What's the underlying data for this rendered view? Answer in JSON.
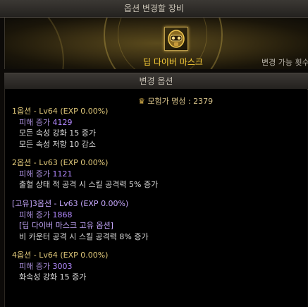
{
  "header": {
    "title": "옵션 변경할 장비"
  },
  "equipment": {
    "icon": "mask-item-icon",
    "name": "딥 다이버 마스크",
    "change_count_label": "변경 가능 횟수"
  },
  "section": {
    "title": "변경 옵션"
  },
  "fame": {
    "label": "모험가 명성 : 2379",
    "icon": "fame-icon"
  },
  "options": [
    {
      "title": "1옵션 - Lv64 (EXP 0.00%)",
      "damage_label": "피해 증가",
      "damage_value": "4129",
      "lines": [
        "모든 속성 강화 15 증가",
        "모든 속성 저항 10 감소"
      ]
    },
    {
      "title": "2옵션 - Lv63 (EXP 0.00%)",
      "damage_label": "피해 증가",
      "damage_value": "1121",
      "lines": [
        "출혈 상태 적 공격 시 스킬 공격력 5% 증가"
      ]
    },
    {
      "title": "[고유]3옵션 - Lv63 (EXP 0.00%)",
      "damage_label": "피해 증가",
      "damage_value": "1868",
      "unique_label": "[딥 다이버 마스크 고유 옵션]",
      "lines": [
        "비 카운터 공격 시 스킬 공격력 8% 증가"
      ]
    },
    {
      "title": "4옵션 - Lv64 (EXP 0.00%)",
      "damage_label": "피해 증가",
      "damage_value": "3003",
      "lines": [
        "화속성 강화 15 증가"
      ]
    }
  ],
  "colors": {
    "gold": "#ffd23a",
    "purple": "#b388ff",
    "title": "#e0c87a"
  }
}
